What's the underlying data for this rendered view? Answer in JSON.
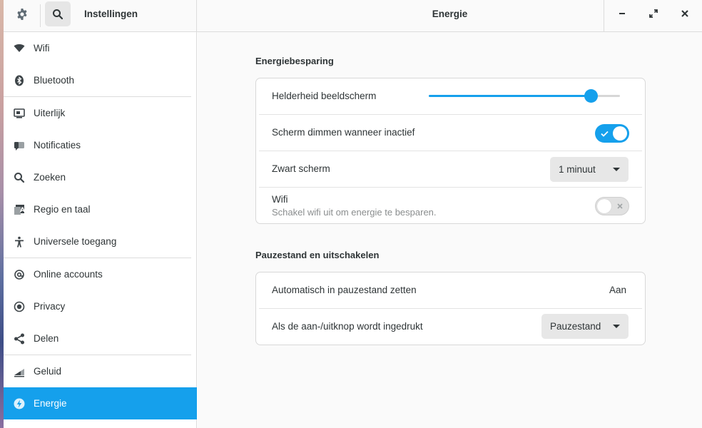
{
  "header": {
    "app_title": "Instellingen",
    "page_title": "Energie"
  },
  "sidebar": {
    "items": [
      {
        "label": "Wifi",
        "icon": "wifi-icon"
      },
      {
        "label": "Bluetooth",
        "icon": "bluetooth-icon"
      },
      {
        "label": "Uiterlijk",
        "icon": "appearance-icon"
      },
      {
        "label": "Notificaties",
        "icon": "notifications-icon"
      },
      {
        "label": "Zoeken",
        "icon": "search-icon"
      },
      {
        "label": "Regio en taal",
        "icon": "region-icon"
      },
      {
        "label": "Universele toegang",
        "icon": "accessibility-icon"
      },
      {
        "label": "Online accounts",
        "icon": "online-accounts-icon"
      },
      {
        "label": "Privacy",
        "icon": "privacy-icon"
      },
      {
        "label": "Delen",
        "icon": "share-icon"
      },
      {
        "label": "Geluid",
        "icon": "sound-icon"
      },
      {
        "label": "Energie",
        "icon": "power-icon",
        "active": true
      }
    ]
  },
  "energy_saving": {
    "title": "Energiebesparing",
    "brightness": {
      "label": "Helderheid beeldscherm",
      "value_percent": 85
    },
    "dim_screen": {
      "label": "Scherm dimmen wanneer inactief",
      "enabled": true
    },
    "blank_screen": {
      "label": "Zwart scherm",
      "value": "1 minuut"
    },
    "wifi": {
      "label": "Wifi",
      "sublabel": "Schakel wifi uit om energie te besparen.",
      "enabled": false
    }
  },
  "suspend": {
    "title": "Pauzestand en uitschakelen",
    "auto_suspend": {
      "label": "Automatisch in pauzestand zetten",
      "value": "Aan"
    },
    "power_button": {
      "label": "Als de aan-/uitknop wordt ingedrukt",
      "value": "Pauzestand"
    }
  },
  "colors": {
    "accent": "#15a0ec",
    "text": "#2e3436",
    "subtext": "#8a8d8e"
  }
}
